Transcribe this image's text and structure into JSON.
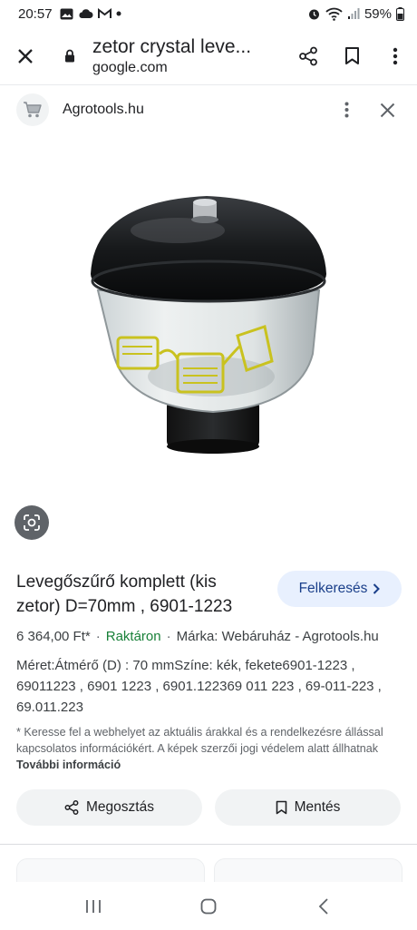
{
  "status_bar": {
    "time": "20:57",
    "battery": "59%",
    "icons": [
      "gallery-icon",
      "cloud-icon",
      "gmail-icon",
      "dot-icon",
      "alarm-icon",
      "wifi-icon",
      "signal-icon",
      "battery-icon"
    ]
  },
  "browser": {
    "page_title": "zetor crystal leve...",
    "domain": "google.com",
    "icons": [
      "close-icon",
      "lock-icon",
      "share-icon",
      "bookmark-icon",
      "more-vert-icon"
    ]
  },
  "source": {
    "name": "Agrotools.hu",
    "icons": [
      "cart-icon",
      "more-vert-icon",
      "close-icon"
    ]
  },
  "image": {
    "description_icon": "lens-icon"
  },
  "product": {
    "title": "Levegőszűrő komplett (kis zetor) D=70mm , 6901-1223",
    "visit_label": "Felkeresés",
    "price": "6 364,00 Ft*",
    "stock": "Raktáron",
    "brand": "Márka: Webáruház - Agrotools.hu",
    "description": "Méret:Átmérő (D) : 70 mmSzíne: kék, fekete6901-1223 , 69011223 , 6901 1223 , 6901.122369 011 223 , 69-011-223 , 69.011.223",
    "disclaimer": "* Keresse fel a webhelyet az aktuális árakkal és a rendelkezésre állással kapcsolatos információkért. A képek szerzői jogi védelem alatt állhatnak",
    "more_info": "További információ"
  },
  "actions": {
    "share_label": "Megosztás",
    "save_label": "Mentés"
  },
  "colors": {
    "accent_button_bg": "#e8f0fe",
    "accent_button_text": "#1a3f8a",
    "stock_green": "#188038"
  }
}
